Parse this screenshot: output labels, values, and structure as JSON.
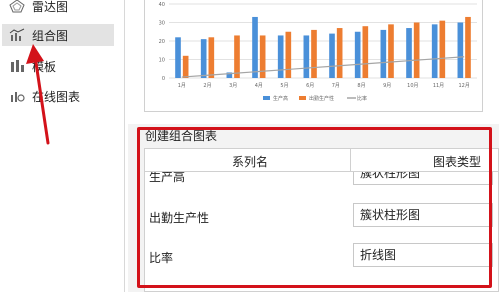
{
  "sidebar": {
    "items": [
      {
        "label": "雷达图",
        "icon": "radar-chart-icon"
      },
      {
        "label": "组合图",
        "icon": "combo-chart-icon",
        "active": true
      },
      {
        "label": "模板",
        "icon": "template-icon"
      },
      {
        "label": "在线图表",
        "icon": "online-chart-icon"
      }
    ]
  },
  "preview": {
    "chart_data": {
      "type": "bar",
      "categories": [
        "1月",
        "2月",
        "3月",
        "4月",
        "5月",
        "6月",
        "7月",
        "8月",
        "9月",
        "10月",
        "11月",
        "12月"
      ],
      "ylim": [
        0,
        40
      ],
      "yticks": [
        "0",
        "10",
        "20",
        "30",
        "40"
      ],
      "series": [
        {
          "name": "生产高",
          "type": "bar",
          "color": "#4a90d9",
          "values": [
            22,
            21,
            3,
            33,
            23,
            23,
            24,
            25,
            26,
            27,
            29,
            30
          ]
        },
        {
          "name": "出勤生产性",
          "type": "bar",
          "color": "#ed7d31",
          "values": [
            12,
            22,
            23,
            23,
            25,
            26,
            27,
            28,
            29,
            30,
            31,
            33
          ]
        },
        {
          "name": "比率",
          "type": "line",
          "color": "#a5a5a5",
          "values": [
            0.5,
            1.5,
            2.5,
            3.5,
            4.5,
            5.5,
            6.5,
            7.5,
            8.5,
            9.5,
            10.5,
            11.5
          ]
        }
      ],
      "legend_position": "bottom"
    }
  },
  "combo": {
    "section_title": "创建组合图表",
    "col_series": "系列名",
    "col_type": "图表类型",
    "rows": [
      {
        "name": "生产高",
        "type": "簇状柱形图"
      },
      {
        "name": "出勤生产性",
        "type": "簇状柱形图"
      },
      {
        "name": "比率",
        "type": "折线图"
      }
    ]
  },
  "colors": {
    "highlight": "#d3121a",
    "sidebar_active": "#e3e3e3"
  }
}
